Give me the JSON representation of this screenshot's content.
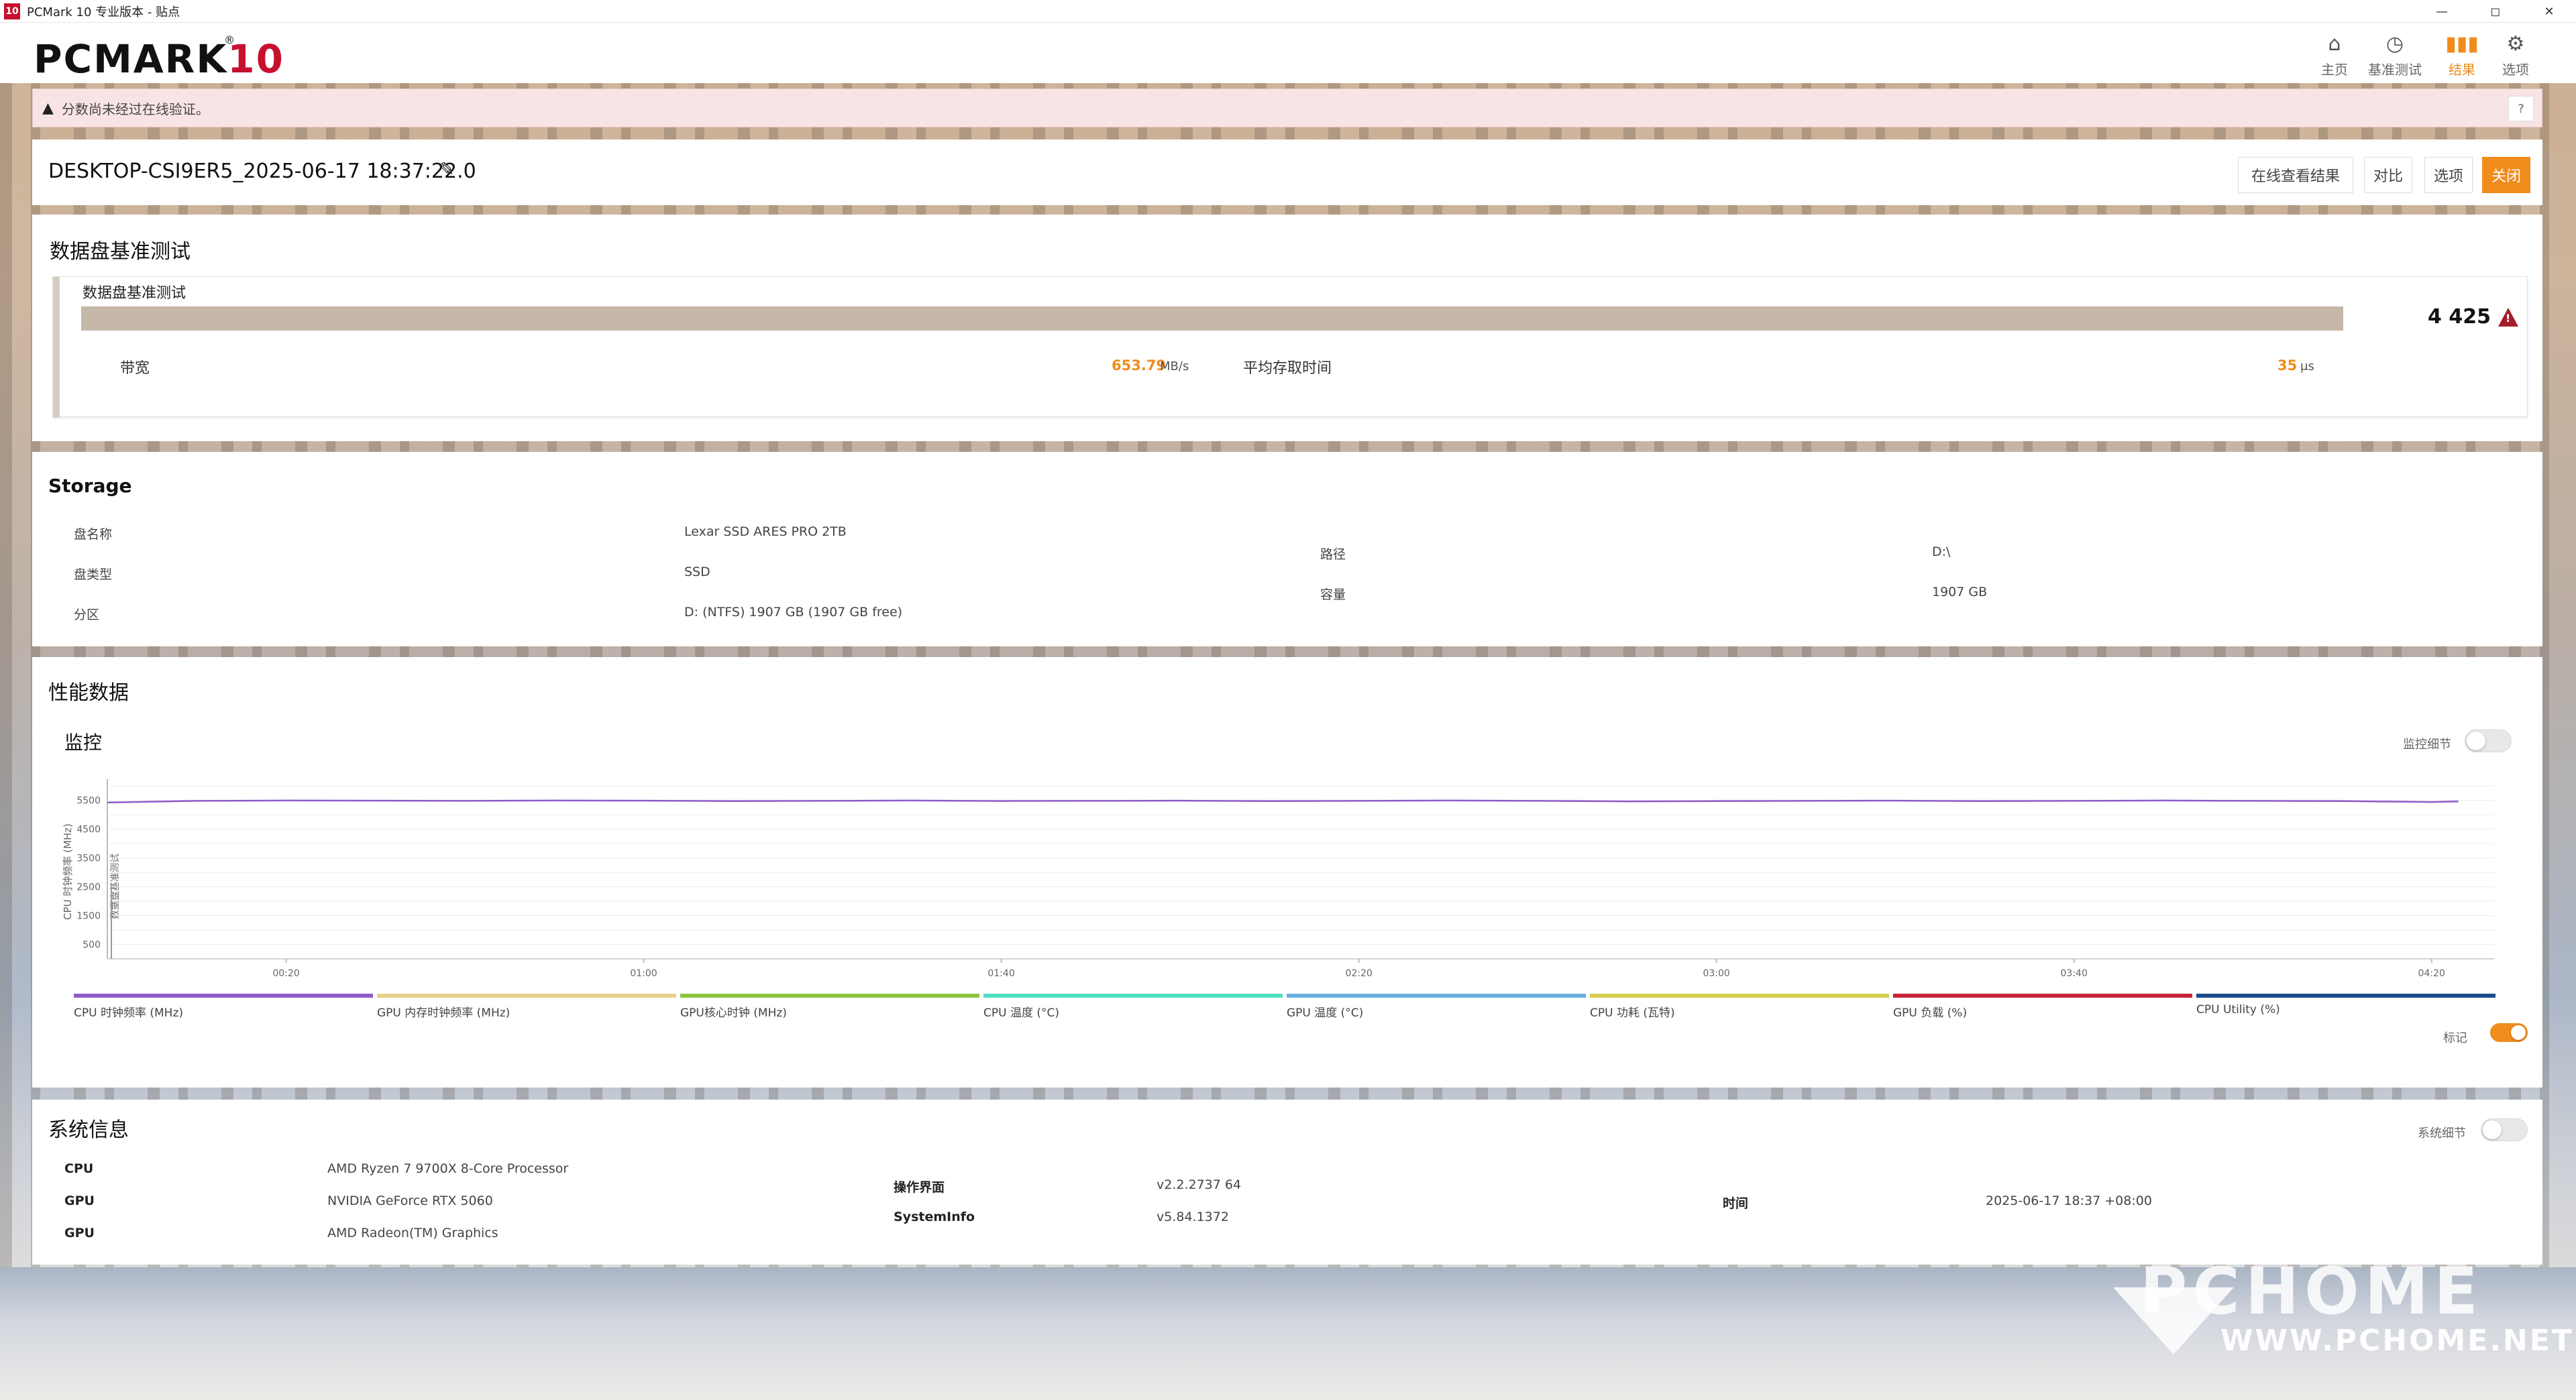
{
  "window": {
    "app_icon_text": "10",
    "title": "PCMark 10 专业版本 - 贴点",
    "controls": [
      "—",
      "◻",
      "✕"
    ]
  },
  "header": {
    "logo_main": "PCMARK",
    "logo_num": "10",
    "logo_reg": "®",
    "nav": [
      {
        "label": "主页",
        "icon": "home-icon"
      },
      {
        "label": "基准测试",
        "icon": "benchmark-icon"
      },
      {
        "label": "结果",
        "icon": "results-icon",
        "active": true
      },
      {
        "label": "选项",
        "icon": "gear-icon"
      }
    ]
  },
  "warning": {
    "text": "分数尚未经过在线验证。",
    "help": "?"
  },
  "result": {
    "title": "DESKTOP-CSI9ER5_2025-06-17 18:37:22.0",
    "buttons": {
      "view_online": "在线查看结果",
      "compare": "对比",
      "options": "选项",
      "close": "关闭"
    }
  },
  "benchmark": {
    "section_title": "数据盘基准测试",
    "test_name": "数据盘基准测试",
    "score": "4 425",
    "bandwidth_label": "带宽",
    "bandwidth_value": "653.79",
    "bandwidth_unit": "MB/s",
    "latency_label": "平均存取时间",
    "latency_value": "35",
    "latency_unit": "μs"
  },
  "storage": {
    "title": "Storage",
    "left": [
      {
        "label": "盘名称",
        "value": "Lexar SSD ARES PRO 2TB"
      },
      {
        "label": "盘类型",
        "value": "SSD"
      },
      {
        "label": "分区",
        "value": "D: (NTFS) 1907 GB (1907 GB free)"
      }
    ],
    "right": [
      {
        "label": "路径",
        "value": "D:\\"
      },
      {
        "label": "容量",
        "value": "1907 GB"
      }
    ]
  },
  "performance": {
    "title": "性能数据",
    "monitor_title": "监控",
    "monitor_detail_label": "监控细节",
    "marker_label": "标记",
    "legend": [
      {
        "name": "CPU 时钟频率 (MHz)",
        "color": "#8e5bc8"
      },
      {
        "name": "GPU 内存时钟频率 (MHz)",
        "color": "#e8cf8a"
      },
      {
        "name": "GPU核心时钟 (MHz)",
        "color": "#8cc43c"
      },
      {
        "name": "CPU 温度 (°C)",
        "color": "#4fe0c4"
      },
      {
        "name": "GPU 温度 (°C)",
        "color": "#6aaee0"
      },
      {
        "name": "CPU 功耗 (瓦特)",
        "color": "#d6cf52"
      },
      {
        "name": "GPU 负载 (%)",
        "color": "#c8243a"
      },
      {
        "name": "CPU Utility (%)",
        "color": "#1c4c8c"
      }
    ]
  },
  "chart_data": {
    "type": "line",
    "ylabel": "CPU 时钟频率 (MHz)",
    "yticks": [
      500,
      1500,
      2500,
      3500,
      4500,
      5500
    ],
    "ylim": [
      0,
      6000
    ],
    "xticks": [
      "00:20",
      "01:00",
      "01:40",
      "02:20",
      "03:00",
      "03:40",
      "04:20"
    ],
    "xlim_seconds": [
      0,
      267
    ],
    "marker_text": "数据盘基准测试",
    "series": [
      {
        "name": "CPU 时钟频率 (MHz)",
        "x": [
          0,
          10,
          20,
          30,
          40,
          50,
          60,
          70,
          80,
          90,
          100,
          110,
          120,
          130,
          140,
          150,
          160,
          170,
          180,
          190,
          200,
          210,
          220,
          230,
          240,
          250,
          260,
          263
        ],
        "values": [
          5420,
          5480,
          5490,
          5485,
          5480,
          5490,
          5485,
          5470,
          5480,
          5490,
          5475,
          5480,
          5485,
          5470,
          5480,
          5490,
          5480,
          5460,
          5470,
          5480,
          5485,
          5470,
          5480,
          5490,
          5480,
          5470,
          5440,
          5460
        ]
      }
    ]
  },
  "sysinfo": {
    "title": "系统信息",
    "detail_label": "系统细节",
    "col1": [
      {
        "label": "CPU",
        "value": "AMD Ryzen 7 9700X 8-Core Processor"
      },
      {
        "label": "GPU",
        "value": "NVIDIA GeForce RTX 5060"
      },
      {
        "label": "GPU",
        "value": "AMD Radeon(TM) Graphics"
      }
    ],
    "col2": [
      {
        "label": "操作界面",
        "value": "v2.2.2737 64"
      },
      {
        "label": "SystemInfo",
        "value": "v5.84.1372"
      }
    ],
    "col3": [
      {
        "label": "时间",
        "value": "2025-06-17 18:37 +08:00"
      }
    ]
  },
  "watermark": {
    "big": "PCHOME",
    "small": "WWW.PCHOME.NET"
  }
}
